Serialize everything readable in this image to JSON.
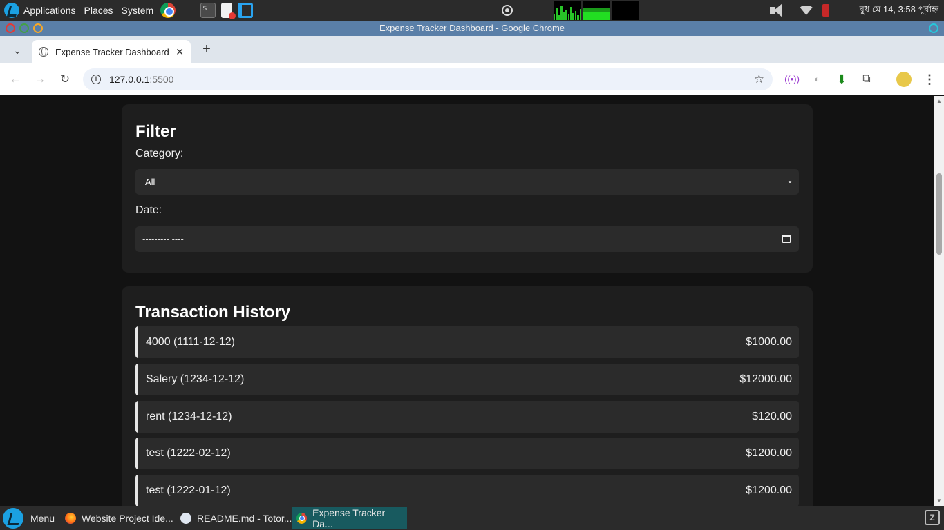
{
  "system_panel": {
    "applications_label": "Applications",
    "places_label": "Places",
    "system_label": "System",
    "clock": "বুধ মে 14,  3:58 পূর্বাহ্ন"
  },
  "window": {
    "title": "Expense Tracker Dashboard - Google Chrome"
  },
  "browser": {
    "tab_title": "Expense Tracker Dashboard",
    "tab_close": "✕",
    "new_tab": "+",
    "url_host": "127.0.0.1",
    "url_port": ":5500"
  },
  "filter": {
    "heading": "Filter",
    "category_label": "Category:",
    "category_selected": "All",
    "date_label": "Date:",
    "date_placeholder": "--------- ----"
  },
  "history": {
    "heading": "Transaction History",
    "items": [
      {
        "desc": "4000 (1111-12-12)",
        "amount": "$1000.00"
      },
      {
        "desc": "Salery (1234-12-12)",
        "amount": "$12000.00"
      },
      {
        "desc": "rent (1234-12-12)",
        "amount": "$120.00"
      },
      {
        "desc": "test (1222-02-12)",
        "amount": "$1200.00"
      },
      {
        "desc": "test (1222-01-12)",
        "amount": "$1200.00"
      }
    ]
  },
  "taskbar": {
    "menu_label": "Menu",
    "items": [
      {
        "label": "Website Project Ide..."
      },
      {
        "label": "README.md - Totor..."
      },
      {
        "label": "Expense Tracker Da..."
      }
    ]
  }
}
